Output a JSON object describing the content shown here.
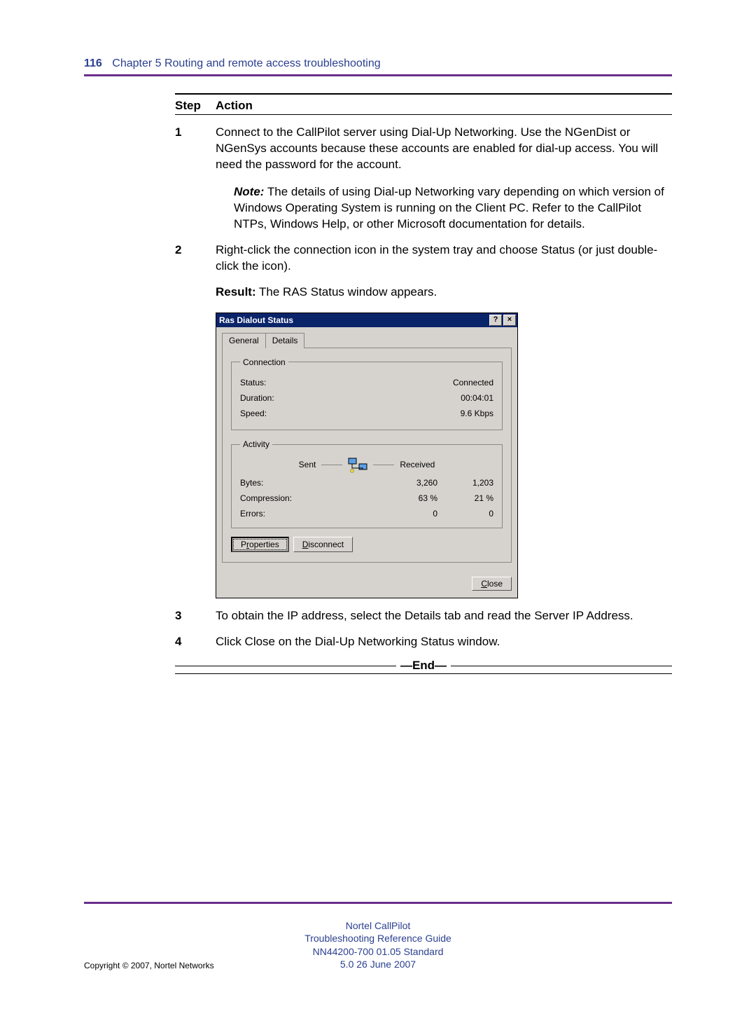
{
  "header": {
    "page_num": "116",
    "chapter": "Chapter 5  Routing and remote access troubleshooting"
  },
  "table_header": {
    "step": "Step",
    "action": "Action"
  },
  "steps": {
    "s1": {
      "num": "1",
      "text": "Connect to the CallPilot server using Dial-Up Networking.  Use the NGenDist or NGenSys accounts because these accounts are enabled for dial-up access.  You will need the password for the account.",
      "note_label": "Note:",
      "note_text": " The details of using Dial-up Networking vary depending on which version of Windows Operating System is running on the Client PC. Refer to the CallPilot NTPs, Windows Help, or other Microsoft documentation for details."
    },
    "s2": {
      "num": "2",
      "text": "Right-click the connection icon in the system tray and choose Status (or just double-click the icon).",
      "result_label": "Result:",
      "result_text": " The RAS Status window appears."
    },
    "s3": {
      "num": "3",
      "text": "To obtain the IP address, select the Details tab and read the Server IP Address."
    },
    "s4": {
      "num": "4",
      "text": "Click Close on the Dial-Up Networking Status window."
    }
  },
  "end_label": "—End—",
  "dialog": {
    "title": "Ras Dialout Status",
    "help": "?",
    "close_x": "×",
    "tabs": {
      "general": "General",
      "details": "Details"
    },
    "connection": {
      "legend": "Connection",
      "status_l": "Status:",
      "status_v": "Connected",
      "duration_l": "Duration:",
      "duration_v": "00:04:01",
      "speed_l": "Speed:",
      "speed_v": "9.6 Kbps"
    },
    "activity": {
      "legend": "Activity",
      "sent": "Sent",
      "received": "Received",
      "bytes_l": "Bytes:",
      "bytes_s": "3,260",
      "bytes_r": "1,203",
      "comp_l": "Compression:",
      "comp_s": "63 %",
      "comp_r": "21 %",
      "err_l": "Errors:",
      "err_s": "0",
      "err_r": "0"
    },
    "buttons": {
      "properties_pre": "P",
      "properties_ul": "r",
      "properties_post": "operties",
      "disconnect_pre": "",
      "disconnect_ul": "D",
      "disconnect_post": "isconnect",
      "close_pre": "",
      "close_ul": "C",
      "close_post": "lose"
    }
  },
  "footer": {
    "l1": "Nortel CallPilot",
    "l2": "Troubleshooting Reference Guide",
    "l3": "NN44200-700   01.05   Standard",
    "l4": "5.0   26 June 2007",
    "copyright": "Copyright © 2007, Nortel Networks"
  }
}
